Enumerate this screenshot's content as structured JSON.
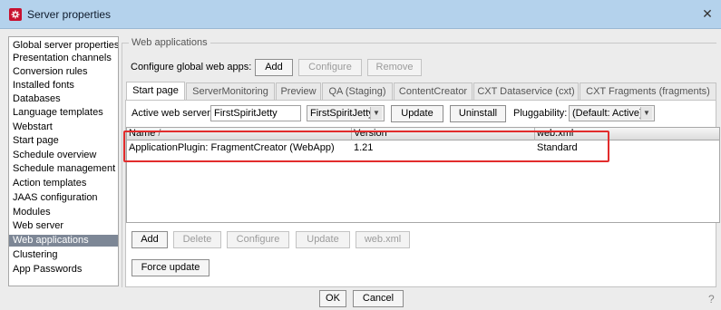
{
  "window": {
    "title": "Server properties",
    "close_glyph": "✕"
  },
  "nav": {
    "items": [
      {
        "label": "Global server properties",
        "selected": false
      },
      {
        "label": "Presentation channels",
        "selected": false
      },
      {
        "label": "Conversion rules",
        "selected": false
      },
      {
        "label": "Installed fonts",
        "selected": false
      },
      {
        "label": "Databases",
        "selected": false
      },
      {
        "label": "Language templates",
        "selected": false
      },
      {
        "label": "Webstart",
        "selected": false
      },
      {
        "label": "Start page",
        "selected": false
      },
      {
        "label": "Schedule overview",
        "selected": false
      },
      {
        "label": "Schedule management",
        "selected": false
      },
      {
        "label": "Action templates",
        "selected": false
      },
      {
        "label": "JAAS configuration",
        "selected": false
      },
      {
        "label": "Modules",
        "selected": false
      },
      {
        "label": "Web server",
        "selected": false
      },
      {
        "label": "Web applications",
        "selected": true
      },
      {
        "label": "Clustering",
        "selected": false
      },
      {
        "label": "App Passwords",
        "selected": false
      }
    ]
  },
  "group": {
    "title": "Web applications"
  },
  "global": {
    "label": "Configure global web apps:",
    "add": "Add",
    "configure": "Configure",
    "remove": "Remove"
  },
  "tabs": [
    {
      "label": "Start page",
      "active": true
    },
    {
      "label": "ServerMonitoring",
      "active": false
    },
    {
      "label": "Preview",
      "active": false
    },
    {
      "label": "QA (Staging)",
      "active": false
    },
    {
      "label": "ContentCreator",
      "active": false
    },
    {
      "label": "CXT Dataservice (cxt)",
      "active": false
    },
    {
      "label": "CXT Fragments (fragments)",
      "active": false
    }
  ],
  "server": {
    "label": "Active web server:",
    "value": "FirstSpiritJetty",
    "select_value": "FirstSpiritJetty",
    "update": "Update",
    "uninstall": "Uninstall",
    "pluggability_label": "Pluggability:",
    "pluggability_value": "(Default: Active)"
  },
  "table": {
    "columns": [
      "Name",
      "Version",
      "web.xml"
    ],
    "sort_indicator": "/",
    "rows": [
      {
        "name": "ApplicationPlugin: FragmentCreator (WebApp)",
        "version": "1.21",
        "webxml": "Standard"
      }
    ]
  },
  "table_actions": {
    "add": "Add",
    "delete": "Delete",
    "configure": "Configure",
    "update": "Update",
    "webxml": "web.xml"
  },
  "force_update": "Force update",
  "dialog": {
    "ok": "OK",
    "cancel": "Cancel"
  },
  "colors": {
    "accent_highlight": "#e22c2c",
    "selected_nav": "#7d8796",
    "titlebar": "#b4d2ec"
  }
}
